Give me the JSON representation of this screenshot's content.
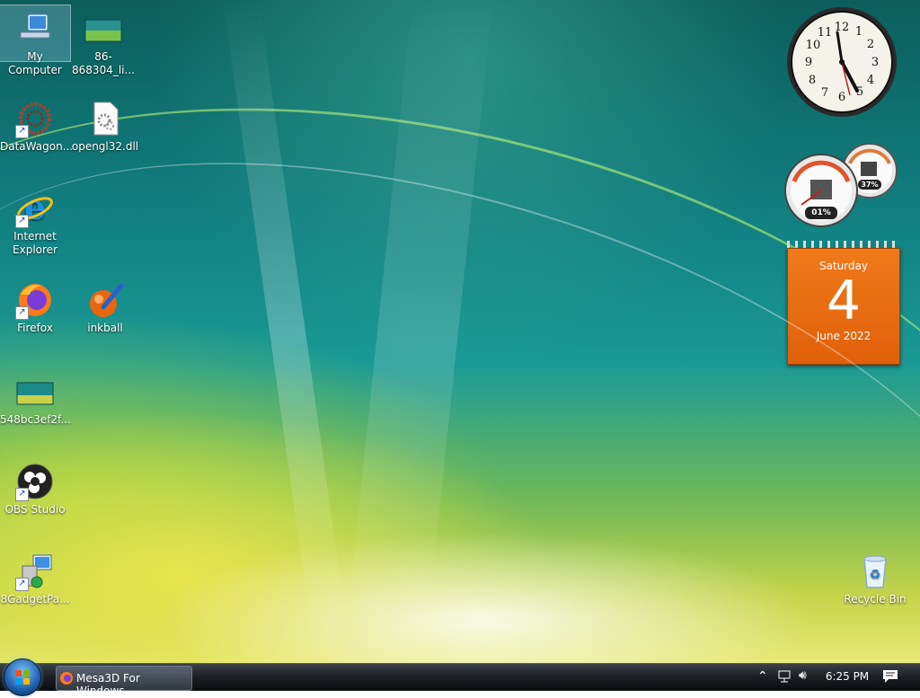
{
  "desktop": {
    "icons": [
      {
        "id": "my-computer",
        "label": "My Computer",
        "icon": "computer-icon"
      },
      {
        "id": "image-file-1",
        "label": "86-868304_li...",
        "icon": "image-thumbnail-icon"
      },
      {
        "id": "datawagon",
        "label": "DataWagon...",
        "icon": "datawagon-icon"
      },
      {
        "id": "opengl32",
        "label": "opengl32.dll",
        "icon": "dll-file-icon"
      },
      {
        "id": "internet-explorer",
        "label": "Internet Explorer",
        "icon": "internet-explorer-icon"
      },
      {
        "id": "firefox",
        "label": "Firefox",
        "icon": "firefox-icon"
      },
      {
        "id": "inkball",
        "label": "inkball",
        "icon": "inkball-icon"
      },
      {
        "id": "image-file-2",
        "label": "548bc3ef2f...",
        "icon": "image-thumbnail-icon"
      },
      {
        "id": "obs-studio",
        "label": "OBS Studio",
        "icon": "obs-icon"
      },
      {
        "id": "8gadgetpack",
        "label": "8GadgetPa...",
        "icon": "installer-icon"
      },
      {
        "id": "recycle-bin",
        "label": "Recycle Bin",
        "icon": "recycle-bin-icon"
      }
    ]
  },
  "gadgets": {
    "clock": {
      "numbers": [
        "12",
        "1",
        "2",
        "3",
        "4",
        "5",
        "6",
        "7",
        "8",
        "9",
        "10",
        "11"
      ]
    },
    "cpu_meter": {
      "cpu_percent": "01%",
      "memory_percent": "37%"
    },
    "calendar": {
      "weekday": "Saturday",
      "day": "4",
      "month_year": "June 2022"
    }
  },
  "taskbar": {
    "running_app_label": "Mesa3D For Windows...",
    "time": "6:25 PM"
  },
  "colors": {
    "calendar_orange": "#e8670e",
    "taskbar": "#1a1e22"
  }
}
